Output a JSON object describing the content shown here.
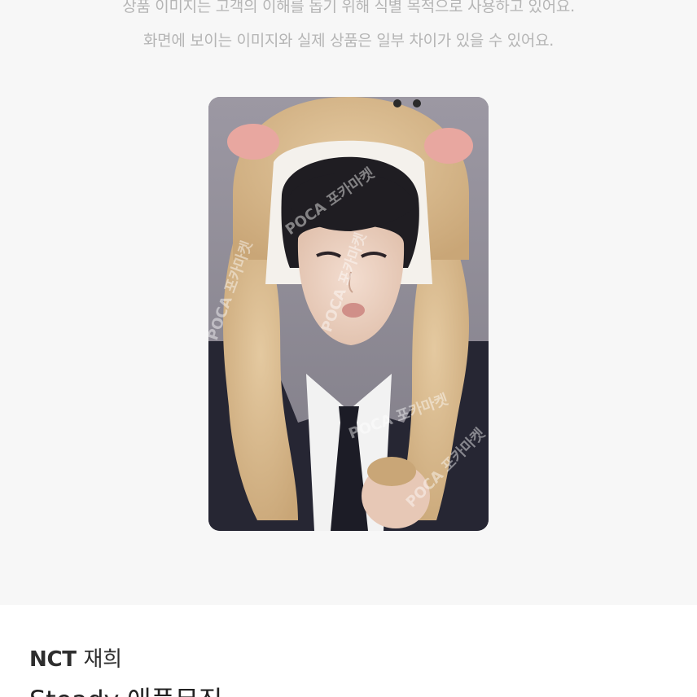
{
  "notice": {
    "line1": "상품 이미지는 고객의 이해를 돕기 위해 식별 목적으로 사용하고 있어요.",
    "line2": "화면에 보이는 이미지와 실제 상품은 일부 차이가 있을 수 있어요."
  },
  "product": {
    "group": "NCT",
    "member": "재희",
    "title": "Steady 애플뮤직"
  },
  "watermark": {
    "text": "POCA 포카마켓"
  },
  "colors": {
    "background": "#f7f7f7",
    "notice_text": "#b5b5b5",
    "title_text": "#222222"
  }
}
